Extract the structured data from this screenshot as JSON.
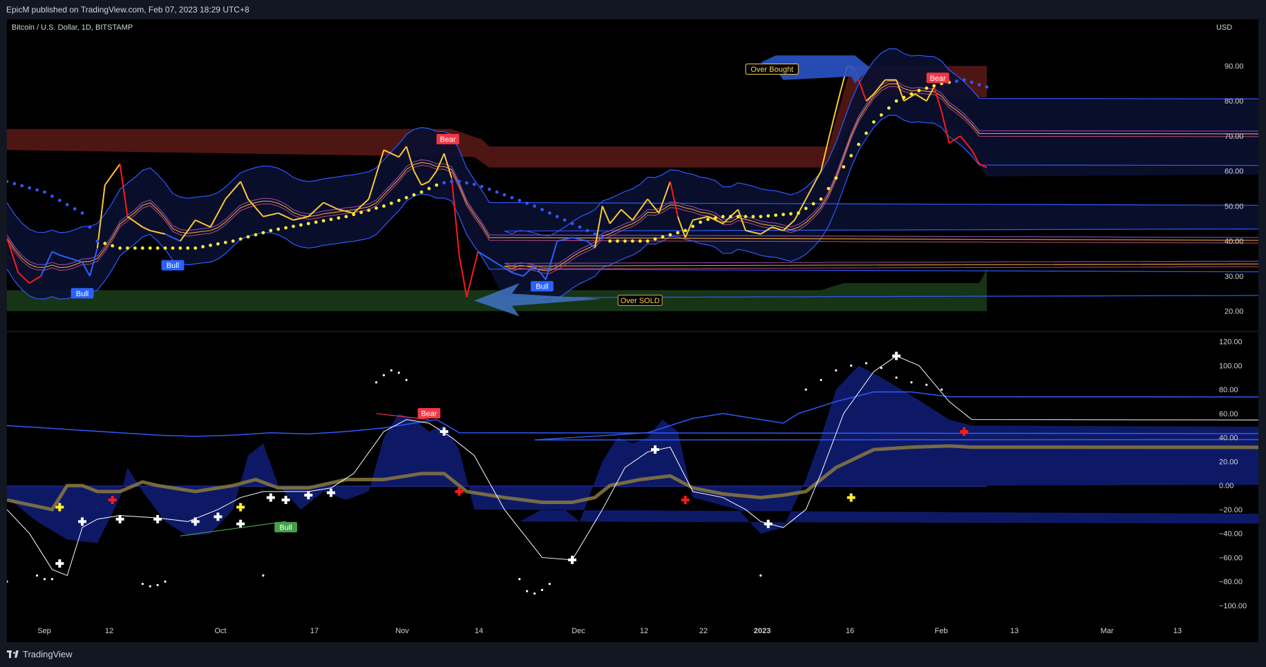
{
  "header": {
    "published": "EpicM published on TradingView.com, Feb 07, 2023 18:29 UTC+8",
    "symbol": "Bitcoin / U.S. Dollar, 1D, BITSTAMP",
    "currency": "USD"
  },
  "footer": {
    "brand": "TradingView"
  },
  "colors": {
    "background": "#000000",
    "frame": "#131722",
    "rsi_up": "#ffc933",
    "rsi_down": "#ff1a1a",
    "rsi_low": "#2962ff",
    "band_blue": "#2e5bff",
    "dots_yellow": "#ffee33",
    "dots_blue": "#3355ff",
    "overbought_zone": "#5c1a16",
    "oversold_zone": "#1a3a1a",
    "wave_blue": "#2962ff",
    "wave_navy": "#0f1a6b",
    "signal_gold": "#8a7a40",
    "bear_label": "#f23645",
    "bull_label": "#2962ff",
    "bull_label_green": "#43a047"
  },
  "chart_data": [
    {
      "type": "line",
      "name": "upper-pane",
      "y_ticks": [
        "90.00",
        "80.00",
        "70.00",
        "60.00",
        "50.00",
        "40.00",
        "30.00",
        "20.00"
      ],
      "ylim": [
        15,
        97
      ],
      "x_ticks": [
        "Sep",
        "12",
        "Oct",
        "17",
        "Nov",
        "14",
        "Dec",
        "12",
        "22",
        "2023",
        "16",
        "Feb",
        "13",
        "Mar",
        "13"
      ],
      "overbought_band": [
        66,
        72
      ],
      "oversold_band": [
        20,
        26
      ],
      "rsi": [
        [
          0,
          41
        ],
        [
          3,
          31
        ],
        [
          6,
          28
        ],
        [
          9,
          30
        ],
        [
          12,
          37
        ],
        [
          14,
          36
        ],
        [
          17,
          35
        ],
        [
          20,
          34
        ],
        [
          22,
          30
        ],
        [
          24,
          38
        ],
        [
          26,
          56
        ],
        [
          30,
          62
        ],
        [
          32,
          47
        ],
        [
          36,
          44
        ],
        [
          38,
          43
        ],
        [
          42,
          42
        ],
        [
          46,
          40
        ],
        [
          50,
          46
        ],
        [
          54,
          44
        ],
        [
          58,
          52
        ],
        [
          62,
          57
        ],
        [
          64,
          52
        ],
        [
          68,
          47
        ],
        [
          72,
          48
        ],
        [
          76,
          46
        ],
        [
          80,
          47
        ],
        [
          84,
          51
        ],
        [
          88,
          49
        ],
        [
          92,
          48
        ],
        [
          96,
          52
        ],
        [
          100,
          66
        ],
        [
          104,
          64
        ],
        [
          106,
          67
        ],
        [
          108,
          60
        ],
        [
          110,
          56
        ],
        [
          112,
          57
        ],
        [
          114,
          60
        ],
        [
          116,
          65
        ],
        [
          118,
          58
        ],
        [
          120,
          36
        ],
        [
          122,
          24
        ],
        [
          125,
          37
        ],
        [
          128,
          35
        ],
        [
          131,
          33
        ],
        [
          134,
          31
        ],
        [
          137,
          30
        ],
        [
          140,
          33
        ],
        [
          143,
          29
        ],
        [
          146,
          40
        ],
        [
          150,
          41
        ],
        [
          154,
          40
        ],
        [
          156,
          38
        ],
        [
          158,
          50
        ],
        [
          160,
          45
        ],
        [
          163,
          49
        ],
        [
          166,
          46
        ],
        [
          170,
          52
        ],
        [
          173,
          48
        ],
        [
          176,
          57
        ],
        [
          178,
          47
        ],
        [
          180,
          41
        ],
        [
          182,
          46
        ],
        [
          186,
          47
        ],
        [
          190,
          45
        ],
        [
          194,
          49
        ],
        [
          196,
          43
        ],
        [
          200,
          42
        ],
        [
          203,
          44
        ],
        [
          206,
          43
        ],
        [
          209,
          46
        ],
        [
          212,
          52
        ],
        [
          216,
          60
        ],
        [
          218,
          69
        ],
        [
          221,
          82
        ],
        [
          223,
          90
        ],
        [
          225,
          89
        ],
        [
          228,
          80
        ],
        [
          230,
          82
        ],
        [
          233,
          86
        ],
        [
          236,
          86
        ],
        [
          238,
          80
        ],
        [
          241,
          82
        ],
        [
          244,
          80
        ],
        [
          246,
          84
        ],
        [
          248,
          77
        ],
        [
          250,
          68
        ],
        [
          253,
          70
        ],
        [
          256,
          66
        ],
        [
          258,
          62
        ],
        [
          260,
          61
        ]
      ],
      "supertrend_dots": [
        [
          0,
          57
        ],
        [
          10,
          54
        ],
        [
          20,
          48
        ],
        [
          24,
          40
        ],
        [
          30,
          38
        ],
        [
          40,
          38
        ],
        [
          50,
          38
        ],
        [
          60,
          40
        ],
        [
          70,
          43
        ],
        [
          80,
          45
        ],
        [
          90,
          47
        ],
        [
          100,
          50
        ],
        [
          110,
          54
        ],
        [
          114,
          56
        ],
        [
          117,
          57
        ],
        [
          120,
          57
        ],
        [
          125,
          56
        ],
        [
          130,
          54
        ],
        [
          140,
          50
        ],
        [
          150,
          45
        ],
        [
          156,
          42
        ],
        [
          160,
          40
        ],
        [
          170,
          40
        ],
        [
          180,
          43
        ],
        [
          185,
          46
        ],
        [
          190,
          47
        ],
        [
          200,
          47
        ],
        [
          210,
          48
        ],
        [
          216,
          52
        ],
        [
          220,
          58
        ],
        [
          225,
          66
        ],
        [
          230,
          74
        ],
        [
          236,
          80
        ],
        [
          242,
          83
        ],
        [
          248,
          85
        ],
        [
          254,
          86
        ],
        [
          260,
          84
        ]
      ],
      "labels": [
        "Over Bought",
        "Over SOLD",
        "Bear",
        "Bear",
        "Bull",
        "Bull",
        "Bull"
      ]
    },
    {
      "type": "area",
      "name": "lower-pane",
      "y_ticks": [
        "120.00",
        "100.00",
        "80.00",
        "60.00",
        "40.00",
        "20.00",
        "0.00",
        "−20.00",
        "−40.00",
        "−60.00",
        "−80.00",
        "−100.00"
      ],
      "ylim": [
        -115,
        125
      ],
      "wave": [
        [
          0,
          -10
        ],
        [
          8,
          -30
        ],
        [
          16,
          -45
        ],
        [
          24,
          -48
        ],
        [
          30,
          -10
        ],
        [
          32,
          15
        ],
        [
          36,
          -5
        ],
        [
          42,
          -30
        ],
        [
          48,
          -42
        ],
        [
          54,
          -40
        ],
        [
          60,
          -20
        ],
        [
          64,
          25
        ],
        [
          68,
          35
        ],
        [
          72,
          0
        ],
        [
          78,
          -20
        ],
        [
          84,
          -5
        ],
        [
          90,
          -12
        ],
        [
          96,
          -5
        ],
        [
          100,
          40
        ],
        [
          104,
          60
        ],
        [
          108,
          55
        ],
        [
          112,
          45
        ],
        [
          116,
          50
        ],
        [
          120,
          30
        ],
        [
          124,
          -20
        ],
        [
          130,
          -40
        ],
        [
          136,
          -30
        ],
        [
          142,
          -20
        ],
        [
          148,
          -20
        ],
        [
          152,
          -30
        ],
        [
          158,
          20
        ],
        [
          162,
          40
        ],
        [
          166,
          35
        ],
        [
          170,
          40
        ],
        [
          174,
          55
        ],
        [
          178,
          45
        ],
        [
          182,
          -10
        ],
        [
          188,
          -15
        ],
        [
          194,
          -20
        ],
        [
          200,
          -40
        ],
        [
          206,
          -35
        ],
        [
          212,
          5
        ],
        [
          216,
          40
        ],
        [
          220,
          80
        ],
        [
          226,
          100
        ],
        [
          232,
          90
        ],
        [
          240,
          75
        ],
        [
          250,
          55
        ],
        [
          256,
          50
        ],
        [
          260,
          20
        ]
      ],
      "white_line": [
        [
          0,
          -20
        ],
        [
          6,
          -40
        ],
        [
          12,
          -70
        ],
        [
          16,
          -75
        ],
        [
          20,
          -35
        ],
        [
          24,
          -28
        ],
        [
          30,
          -25
        ],
        [
          40,
          -27
        ],
        [
          48,
          -30
        ],
        [
          56,
          -20
        ],
        [
          62,
          -10
        ],
        [
          68,
          -5
        ],
        [
          74,
          -5
        ],
        [
          80,
          -5
        ],
        [
          86,
          -2
        ],
        [
          92,
          10
        ],
        [
          100,
          45
        ],
        [
          106,
          55
        ],
        [
          112,
          52
        ],
        [
          118,
          40
        ],
        [
          124,
          25
        ],
        [
          132,
          -20
        ],
        [
          142,
          -60
        ],
        [
          150,
          -62
        ],
        [
          158,
          -20
        ],
        [
          164,
          15
        ],
        [
          170,
          28
        ],
        [
          176,
          32
        ],
        [
          182,
          -5
        ],
        [
          190,
          -10
        ],
        [
          196,
          -20
        ],
        [
          200,
          -30
        ],
        [
          206,
          -35
        ],
        [
          212,
          -20
        ],
        [
          216,
          10
        ],
        [
          222,
          60
        ],
        [
          230,
          95
        ],
        [
          236,
          108
        ],
        [
          242,
          100
        ],
        [
          250,
          70
        ],
        [
          256,
          55
        ],
        [
          260,
          45
        ]
      ],
      "blue_line": [
        [
          0,
          50
        ],
        [
          10,
          48
        ],
        [
          20,
          46
        ],
        [
          30,
          44
        ],
        [
          40,
          42
        ],
        [
          50,
          41
        ],
        [
          60,
          42
        ],
        [
          70,
          44
        ],
        [
          80,
          43
        ],
        [
          90,
          45
        ],
        [
          100,
          48
        ],
        [
          108,
          52
        ],
        [
          114,
          55
        ],
        [
          120,
          44
        ],
        [
          130,
          40
        ],
        [
          140,
          38
        ],
        [
          150,
          40
        ],
        [
          160,
          42
        ],
        [
          170,
          44
        ],
        [
          176,
          50
        ],
        [
          182,
          56
        ],
        [
          190,
          60
        ],
        [
          200,
          55
        ],
        [
          206,
          52
        ],
        [
          210,
          60
        ],
        [
          220,
          70
        ],
        [
          230,
          78
        ],
        [
          240,
          78
        ],
        [
          250,
          74
        ],
        [
          260,
          70
        ]
      ],
      "gold_signal": [
        [
          0,
          -12
        ],
        [
          12,
          -20
        ],
        [
          16,
          0
        ],
        [
          20,
          0
        ],
        [
          24,
          -5
        ],
        [
          30,
          -5
        ],
        [
          36,
          3
        ],
        [
          40,
          0
        ],
        [
          50,
          -5
        ],
        [
          60,
          0
        ],
        [
          66,
          5
        ],
        [
          72,
          -2
        ],
        [
          80,
          -2
        ],
        [
          90,
          5
        ],
        [
          100,
          5
        ],
        [
          110,
          10
        ],
        [
          116,
          10
        ],
        [
          122,
          -5
        ],
        [
          132,
          -10
        ],
        [
          142,
          -14
        ],
        [
          150,
          -14
        ],
        [
          156,
          -10
        ],
        [
          160,
          0
        ],
        [
          168,
          5
        ],
        [
          176,
          8
        ],
        [
          182,
          -2
        ],
        [
          190,
          -7
        ],
        [
          200,
          -10
        ],
        [
          206,
          -8
        ],
        [
          212,
          -5
        ],
        [
          220,
          15
        ],
        [
          230,
          30
        ],
        [
          240,
          32
        ],
        [
          250,
          33
        ],
        [
          256,
          32
        ],
        [
          260,
          28
        ]
      ],
      "labels": [
        "Bear",
        "Bull"
      ]
    }
  ]
}
